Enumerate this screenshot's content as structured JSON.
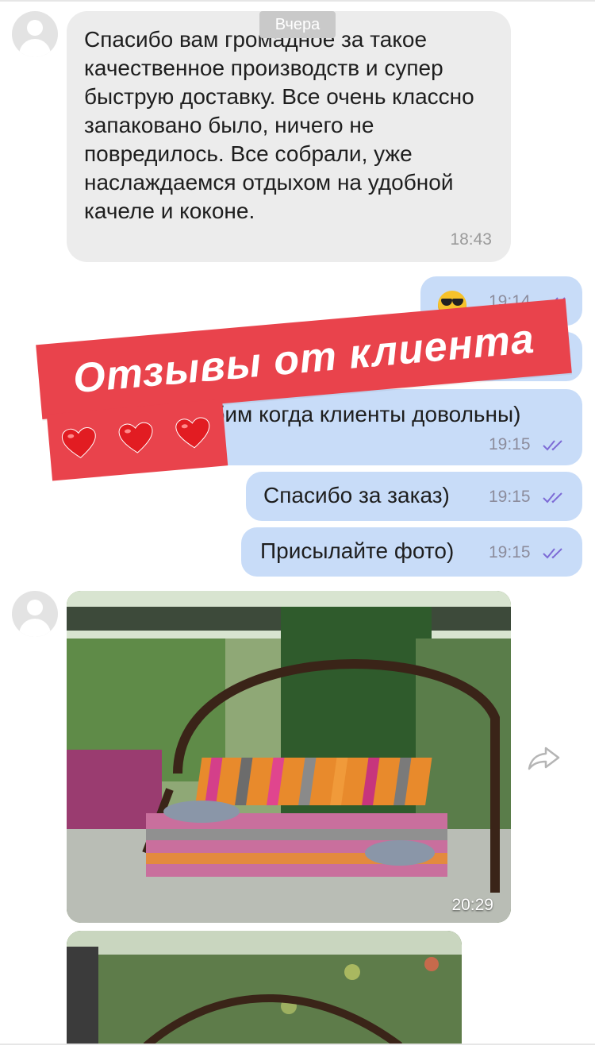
{
  "chat": {
    "date_separator": "Вчера",
    "incoming_message": {
      "text": "Спасибо вам громадное за такое качественное производств и супер быструю доставку. Все очень классно запаковано было, ничего не повредилось. Все собрали, уже наслаждаемся отдыхом на удобной качеле и коконе.",
      "time": "18:43"
    },
    "outgoing": [
      {
        "text": "",
        "emoji": "smiling-face-with-sunglasses",
        "time": "19:14"
      },
      {
        "text": "Любим когда клиенты довольны)",
        "time": "19:15"
      },
      {
        "text": "Спасибо за заказ)",
        "time": "19:15"
      },
      {
        "text": "Присылайте фото)",
        "time": "19:15"
      }
    ],
    "photo_message": {
      "time": "20:29"
    }
  },
  "overlay": {
    "title": "Отзывы от клиента",
    "hearts_count": 3,
    "accent_color": "#e9434c"
  },
  "colors": {
    "incoming_bubble": "#ececec",
    "outgoing_bubble": "#c8dcf8",
    "read_ticks": "#7d6bd6"
  }
}
